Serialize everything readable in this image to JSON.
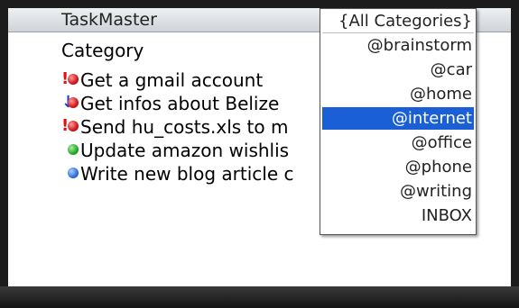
{
  "app": {
    "title": "TaskMaster"
  },
  "list": {
    "header": "Category",
    "tasks": [
      {
        "priority": "!",
        "priority_level": "high",
        "status_color": "red",
        "label": "Get a gmail account"
      },
      {
        "priority": "↓",
        "priority_level": "low",
        "status_color": "red",
        "label": "Get infos about Belize"
      },
      {
        "priority": "!",
        "priority_level": "high",
        "status_color": "red",
        "label": "Send hu_costs.xls to m"
      },
      {
        "priority": "",
        "priority_level": "normal",
        "status_color": "green",
        "label": "Update amazon wishlis"
      },
      {
        "priority": "",
        "priority_level": "normal",
        "status_color": "blue",
        "label": "Write new blog article c"
      }
    ]
  },
  "category_menu": {
    "items": [
      "{All Categories}",
      "@brainstorm",
      "@car",
      "@home",
      "@internet",
      "@office",
      "@phone",
      "@writing",
      "INBOX"
    ],
    "selected": "@internet"
  },
  "colors": {
    "selection": "#1a5fd6",
    "priority_high": "#e01010",
    "priority_low": "#1040d0"
  }
}
